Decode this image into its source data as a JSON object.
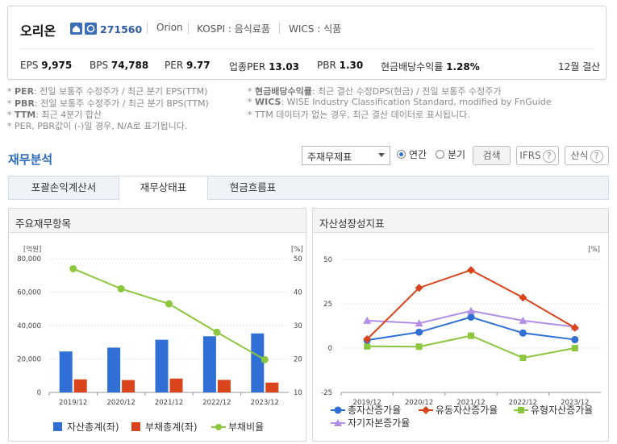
{
  "company": {
    "name": "오리온",
    "code": "271560",
    "english": "Orion",
    "market": "KOSPI : 음식료품",
    "wics": "WICS : 식품"
  },
  "stats": [
    {
      "label": "EPS",
      "value": "9,975"
    },
    {
      "label": "BPS",
      "value": "74,788"
    },
    {
      "label": "PER",
      "value": "9.77"
    },
    {
      "label": "업종PER",
      "value": "13.03"
    },
    {
      "label": "PBR",
      "value": "1.30"
    },
    {
      "label": "현금배당수익률",
      "value": "1.28%"
    }
  ],
  "settlement": "12월 결산",
  "notes": {
    "per_label": "PER",
    "per_text": ": 전일 보통주 수정주가 / 최근 분기 EPS(TTM)",
    "pbr_label": "PBR",
    "pbr_text": ": 전일 보통주 수정주가 / 최근 분기 BPS(TTM)",
    "ttm_label": "TTM",
    "ttm_text": ": 최근 4분기 합산",
    "na_text": "* PER, PBR값이 (-)일 경우, N/A로 표기됩니다.",
    "div_label": "현금배당수익률",
    "div_text": ": 최근 결산 수정DPS(현금) / 전일 보통주 수정주가",
    "wics_label": "WICS",
    "wics_text": ": WISE Industry Classification Standard, modified by FnGuide",
    "ttm_note": "* TTM 데이터가 없는 경우, 최근 결산 데이터로 표시됩니다."
  },
  "section": {
    "title": "재무분석",
    "select_value": "주재무제표",
    "radio_annual": "연간",
    "radio_quarter": "분기",
    "search_btn": "검색",
    "ifrs_btn": "IFRS",
    "formula_btn": "산식",
    "help_icon": "?"
  },
  "tabs": [
    "포괄손익계산서",
    "재무상태표",
    "현금흐름표"
  ],
  "active_tab": 1,
  "panels": {
    "left_title": "주요재무항목",
    "right_title": "자산성장성지표"
  },
  "colors": {
    "asset": "#2f6fd6",
    "debt": "#d9441c",
    "ratio": "#8cc63f",
    "total_growth": "#2f6fd6",
    "current_growth": "#d9441c",
    "tangible_growth": "#8cc63f",
    "equity_growth": "#b38ee6"
  },
  "chart_data": [
    {
      "type": "bar",
      "categories": [
        "2019/12",
        "2020/12",
        "2021/12",
        "2022/12",
        "2023/12"
      ],
      "left_unit": "[억원]",
      "right_unit": "[%]",
      "left_ticks": [
        "80,000",
        "60,000",
        "40,000",
        "20,000",
        "0"
      ],
      "right_ticks": [
        "50",
        "40",
        "30",
        "20",
        "10"
      ],
      "ylim_left": [
        0,
        80000
      ],
      "ylim_right": [
        10,
        50
      ],
      "series": [
        {
          "name": "자산총계(좌)",
          "kind": "bar",
          "axis": "left",
          "values": [
            24500,
            26800,
            31500,
            33600,
            35300
          ]
        },
        {
          "name": "부채총계(좌)",
          "kind": "bar",
          "axis": "left",
          "values": [
            7800,
            7400,
            8300,
            7500,
            5900
          ]
        },
        {
          "name": "부채비율",
          "kind": "line",
          "axis": "right",
          "values": [
            47.0,
            41.0,
            36.5,
            28.0,
            19.8
          ]
        }
      ]
    },
    {
      "type": "line",
      "categories": [
        "2019/12",
        "2020/12",
        "2021/12",
        "2022/12",
        "2023/12"
      ],
      "right_unit": "[%]",
      "ticks": [
        "50",
        "25",
        "0",
        "-25"
      ],
      "ylim": [
        -25,
        50
      ],
      "series": [
        {
          "name": "총자산증가율",
          "values": [
            4.5,
            9.0,
            17.5,
            8.5,
            4.8
          ]
        },
        {
          "name": "유동자산증가율",
          "values": [
            5.0,
            34.0,
            44.0,
            28.5,
            11.5
          ]
        },
        {
          "name": "유형자산증가율",
          "values": [
            1.0,
            0.8,
            7.0,
            -5.5,
            0.0
          ]
        },
        {
          "name": "자기자본증가율",
          "values": [
            15.5,
            14.0,
            21.0,
            15.5,
            12.0
          ]
        }
      ]
    }
  ]
}
